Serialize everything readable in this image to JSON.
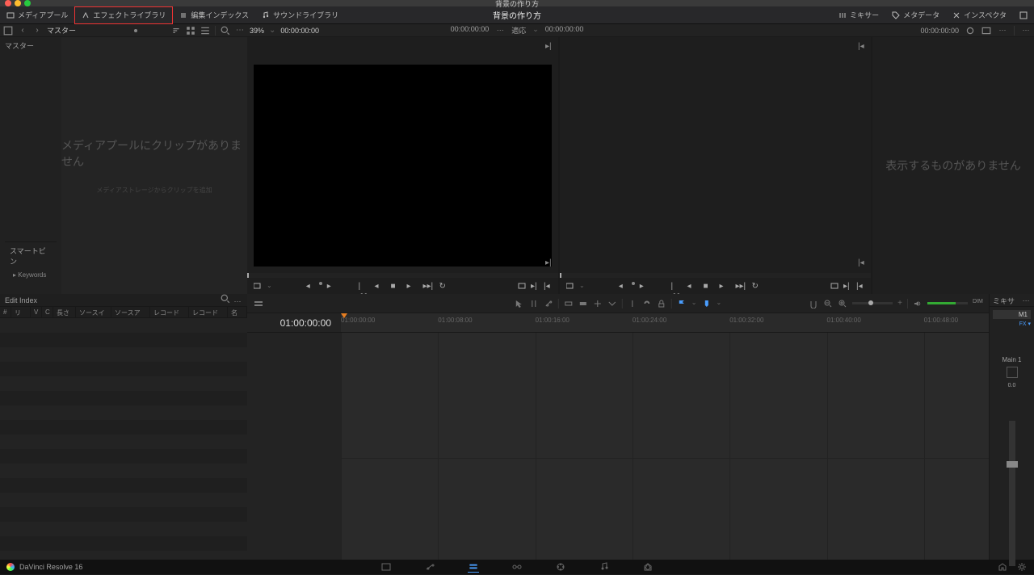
{
  "title": "背景の作り方",
  "topbar": {
    "media_pool": "メディアプール",
    "effects_library": "エフェクトライブラリ",
    "edit_index": "編集インデックス",
    "sound_library": "サウンドライブラリ",
    "mixer": "ミキサー",
    "metadata": "メタデータ",
    "inspector": "インスペクタ"
  },
  "secbar": {
    "master": "マスター",
    "zoom": "39%",
    "tc1": "00:00:00:00",
    "source_tc": "00:00:00:00",
    "fit": "適応",
    "program_tc": "00:00:00:00",
    "right_tc": "00:00:00:00"
  },
  "left_panel": {
    "tree_root": "マスター",
    "empty_msg": "メディアプールにクリップがありません",
    "empty_sub": "メディアストレージからクリップを追加",
    "smartbin": "スマートビン",
    "keywords": "Keywords"
  },
  "right_panel": {
    "empty": "表示するものがありません"
  },
  "edit_index": {
    "title": "Edit Index",
    "cols": [
      "#",
      "リー",
      "V",
      "C",
      "長さ",
      "ソースイン",
      "ソースアウト",
      "レコードイン",
      "レコードアウト",
      "名前"
    ]
  },
  "timeline": {
    "current_tc": "01:00:00:00",
    "ticks": [
      "01:00:00:00",
      "01:00:08:00",
      "01:00:16:00",
      "01:00:24:00",
      "01:00:32:00",
      "01:00:40:00",
      "01:00:48:00"
    ]
  },
  "mixer": {
    "title": "ミキサー",
    "strip": "M1",
    "fx": "FX ▾",
    "main": "Main 1",
    "db": "0.0"
  },
  "bottom": {
    "app": "DaVinci Resolve 16"
  }
}
